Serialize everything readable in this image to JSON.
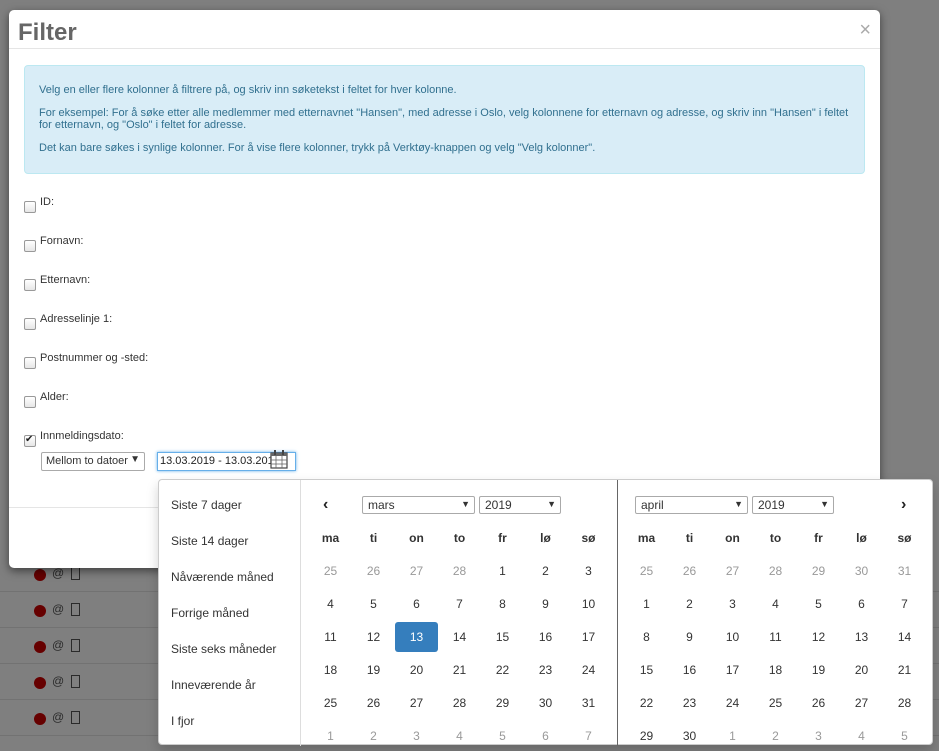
{
  "modal": {
    "title": "Filter",
    "close": "×",
    "info": [
      "Velg en eller flere kolonner å filtrere på, og skriv inn søketekst i feltet for hver kolonne.",
      "For eksempel: For å søke etter alle medlemmer med etternavnet \"Hansen\", med adresse i Oslo, velg kolonnene for etternavn og adresse, og skriv inn \"Hansen\" i feltet for etternavn, og \"Oslo\" i feltet for adresse.",
      "Det kan bare søkes i synlige kolonner. For å vise flere kolonner, trykk på Verktøy-knappen og velg \"Velg kolonner\"."
    ],
    "fields": [
      {
        "label": "ID:",
        "checked": false
      },
      {
        "label": "Fornavn:",
        "checked": false
      },
      {
        "label": "Etternavn:",
        "checked": false
      },
      {
        "label": "Adresselinje 1:",
        "checked": false
      },
      {
        "label": "Postnummer og -sted:",
        "checked": false
      },
      {
        "label": "Alder:",
        "checked": false
      },
      {
        "label": "Innmeldingsdato:",
        "checked": true
      }
    ],
    "range_mode": "Mellom to datoer",
    "date_value": "13.03.2019 - 13.03.2019"
  },
  "picker": {
    "ranges": [
      "Siste 7 dager",
      "Siste 14 dager",
      "Nåværende måned",
      "Forrige måned",
      "Siste seks måneder",
      "Inneværende år",
      "I fjor"
    ],
    "weekdays": [
      "ma",
      "ti",
      "on",
      "to",
      "fr",
      "lø",
      "sø"
    ],
    "left": {
      "month": "mars",
      "year": "2019",
      "weeks": [
        [
          "25",
          "26",
          "27",
          "28",
          "1",
          "2",
          "3"
        ],
        [
          "4",
          "5",
          "6",
          "7",
          "8",
          "9",
          "10"
        ],
        [
          "11",
          "12",
          "13",
          "14",
          "15",
          "16",
          "17"
        ],
        [
          "18",
          "19",
          "20",
          "21",
          "22",
          "23",
          "24"
        ],
        [
          "25",
          "26",
          "27",
          "28",
          "29",
          "30",
          "31"
        ],
        [
          "1",
          "2",
          "3",
          "4",
          "5",
          "6",
          "7"
        ]
      ],
      "off": [
        [
          0,
          0
        ],
        [
          0,
          1
        ],
        [
          0,
          2
        ],
        [
          0,
          3
        ],
        [
          5,
          0
        ],
        [
          5,
          1
        ],
        [
          5,
          2
        ],
        [
          5,
          3
        ],
        [
          5,
          4
        ],
        [
          5,
          5
        ],
        [
          5,
          6
        ]
      ],
      "active": [
        2,
        2
      ]
    },
    "right": {
      "month": "april",
      "year": "2019",
      "weeks": [
        [
          "25",
          "26",
          "27",
          "28",
          "29",
          "30",
          "31"
        ],
        [
          "1",
          "2",
          "3",
          "4",
          "5",
          "6",
          "7"
        ],
        [
          "8",
          "9",
          "10",
          "11",
          "12",
          "13",
          "14"
        ],
        [
          "15",
          "16",
          "17",
          "18",
          "19",
          "20",
          "21"
        ],
        [
          "22",
          "23",
          "24",
          "25",
          "26",
          "27",
          "28"
        ],
        [
          "29",
          "30",
          "1",
          "2",
          "3",
          "4",
          "5"
        ]
      ],
      "off": [
        [
          0,
          0
        ],
        [
          0,
          1
        ],
        [
          0,
          2
        ],
        [
          0,
          3
        ],
        [
          0,
          4
        ],
        [
          0,
          5
        ],
        [
          0,
          6
        ],
        [
          5,
          2
        ],
        [
          5,
          3
        ],
        [
          5,
          4
        ],
        [
          5,
          5
        ],
        [
          5,
          6
        ]
      ],
      "active": null
    }
  },
  "colors": {
    "accent": "#357ebd",
    "info_bg": "#d9edf7",
    "status_dot": "#cc0000"
  }
}
